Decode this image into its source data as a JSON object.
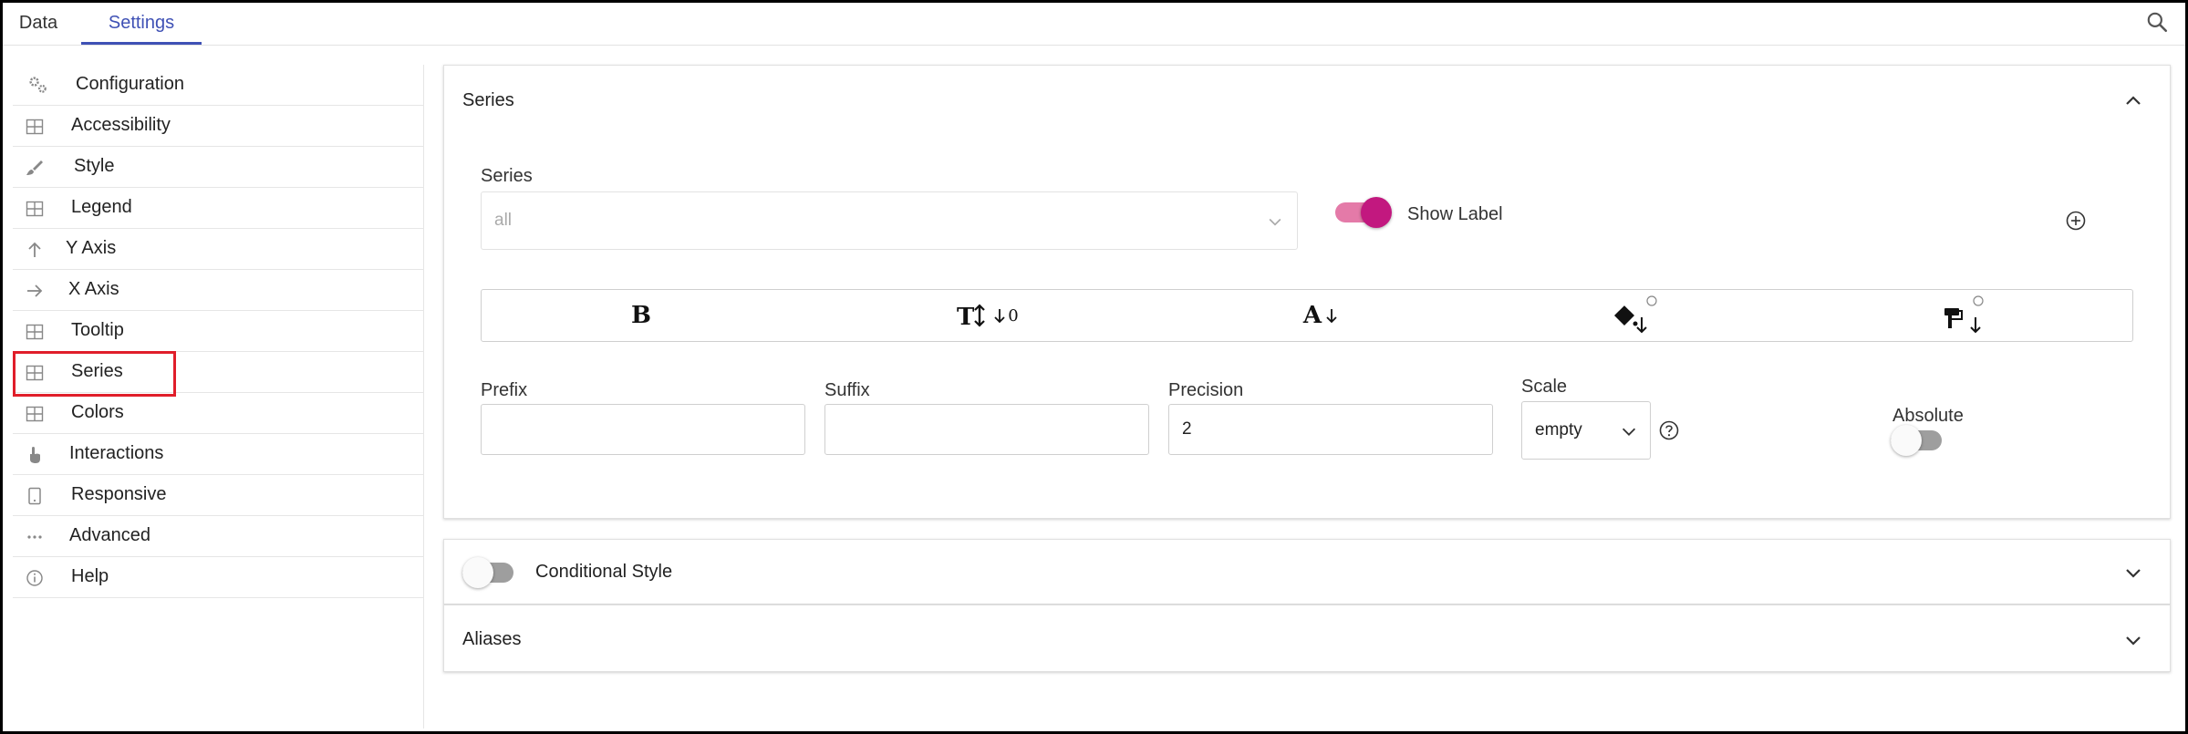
{
  "tabs": [
    {
      "label": "Data"
    },
    {
      "label": "Settings",
      "active": true
    }
  ],
  "sidebar": {
    "selected": "Series",
    "items": [
      {
        "label": "Configuration",
        "icon": "gears-icon"
      },
      {
        "label": "Accessibility",
        "icon": "grid-icon"
      },
      {
        "label": "Style",
        "icon": "brush-icon"
      },
      {
        "label": "Legend",
        "icon": "grid-icon"
      },
      {
        "label": "Y Axis",
        "icon": "arrow-up-icon"
      },
      {
        "label": "X Axis",
        "icon": "arrow-right-icon"
      },
      {
        "label": "Tooltip",
        "icon": "grid-icon"
      },
      {
        "label": "Series",
        "icon": "grid-icon"
      },
      {
        "label": "Colors",
        "icon": "grid-icon"
      },
      {
        "label": "Interactions",
        "icon": "pointer-hand-icon"
      },
      {
        "label": "Responsive",
        "icon": "tablet-icon"
      },
      {
        "label": "Advanced",
        "icon": "more-horizontal-icon"
      },
      {
        "label": "Help",
        "icon": "info-icon"
      }
    ]
  },
  "series_panel": {
    "title": "Series",
    "series_label": "Series",
    "series_value": "all",
    "show_label": {
      "label": "Show Label",
      "on": true
    },
    "format": {
      "bold": "B",
      "font_size_value": "0",
      "font_color_letter": "A"
    },
    "prefix": {
      "label": "Prefix",
      "value": ""
    },
    "suffix": {
      "label": "Suffix",
      "value": ""
    },
    "precision": {
      "label": "Precision",
      "value": "2"
    },
    "scale": {
      "label": "Scale",
      "value": "empty"
    },
    "absolute": {
      "label": "Absolute",
      "on": false
    }
  },
  "conditional_style": {
    "label": "Conditional Style",
    "on": false
  },
  "aliases": {
    "label": "Aliases"
  },
  "colors": {
    "accent": "#3f51b5",
    "toggle_on": "#c2187f",
    "toggle_on_track": "#e47aa8",
    "toggle_off_track": "#9e9e9e",
    "highlight": "#e01e2a"
  }
}
